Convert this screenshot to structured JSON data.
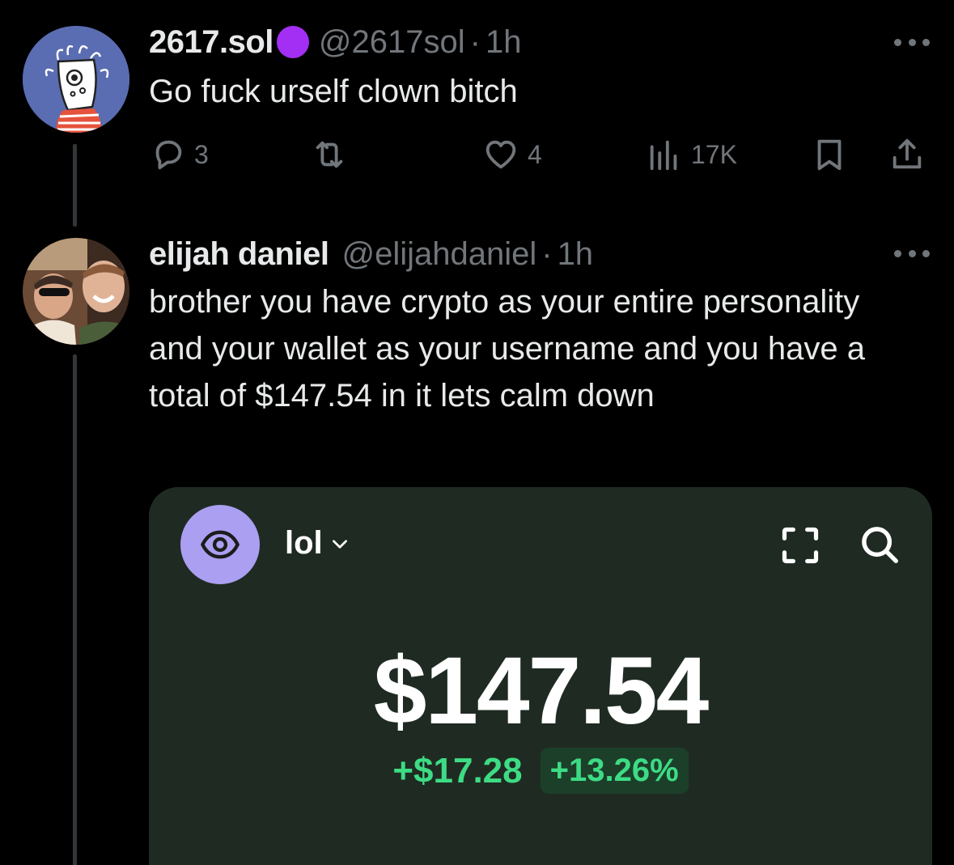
{
  "colors": {
    "background": "#000000",
    "text_primary": "#e7e9ea",
    "text_secondary": "#71767b",
    "thread_line": "#333639",
    "badge": "#a42ff4",
    "card_background": "#1f2b22",
    "wallet_avatar": "#ab9ff2",
    "gain_green": "#3ddc84"
  },
  "tweet1": {
    "display_name": "2617.sol",
    "handle": "@2617sol",
    "separator": "·",
    "time": "1h",
    "text": "Go fuck urself clown bitch",
    "badge_icon": "purple-circle-icon",
    "actions": {
      "replies": "3",
      "reposts": "",
      "likes": "4",
      "views": "17K"
    }
  },
  "tweet2": {
    "display_name": "elijah daniel",
    "handle": "@elijahdaniel",
    "separator": "·",
    "time": "1h",
    "text": "brother you have crypto as your entire personality and your wallet as your username and you have a total of $147.54 in it lets calm down",
    "wallet_card": {
      "wallet_name": "lol",
      "wallet_icon": "eye-icon",
      "balance": "$147.54",
      "change_usd": "+$17.28",
      "change_percent": "+13.26%"
    }
  }
}
